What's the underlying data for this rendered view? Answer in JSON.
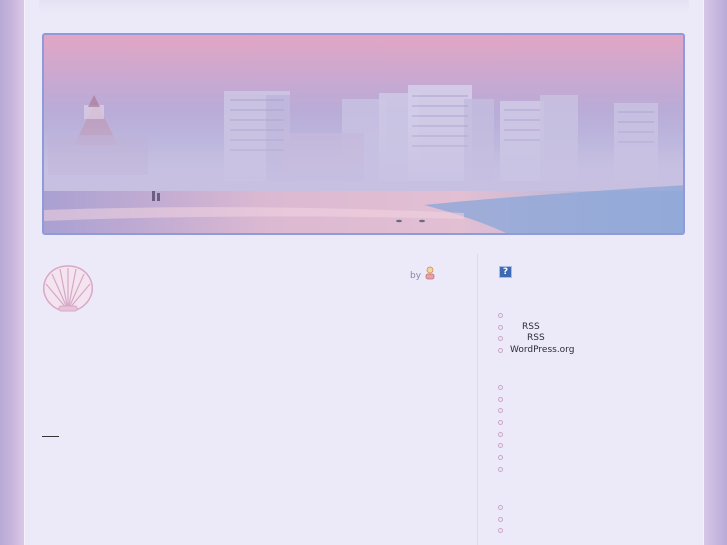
{
  "post": {
    "by_label": "by"
  },
  "sidebar": {
    "meta_help_icon": "?",
    "meta_links": [
      {
        "label": ""
      },
      {
        "label": "RSS"
      },
      {
        "label": "RSS"
      },
      {
        "label": "WordPress.org"
      }
    ],
    "list_two": [
      "",
      "",
      "",
      "",
      "",
      "",
      "",
      ""
    ],
    "list_three": [
      "",
      "",
      ""
    ]
  }
}
